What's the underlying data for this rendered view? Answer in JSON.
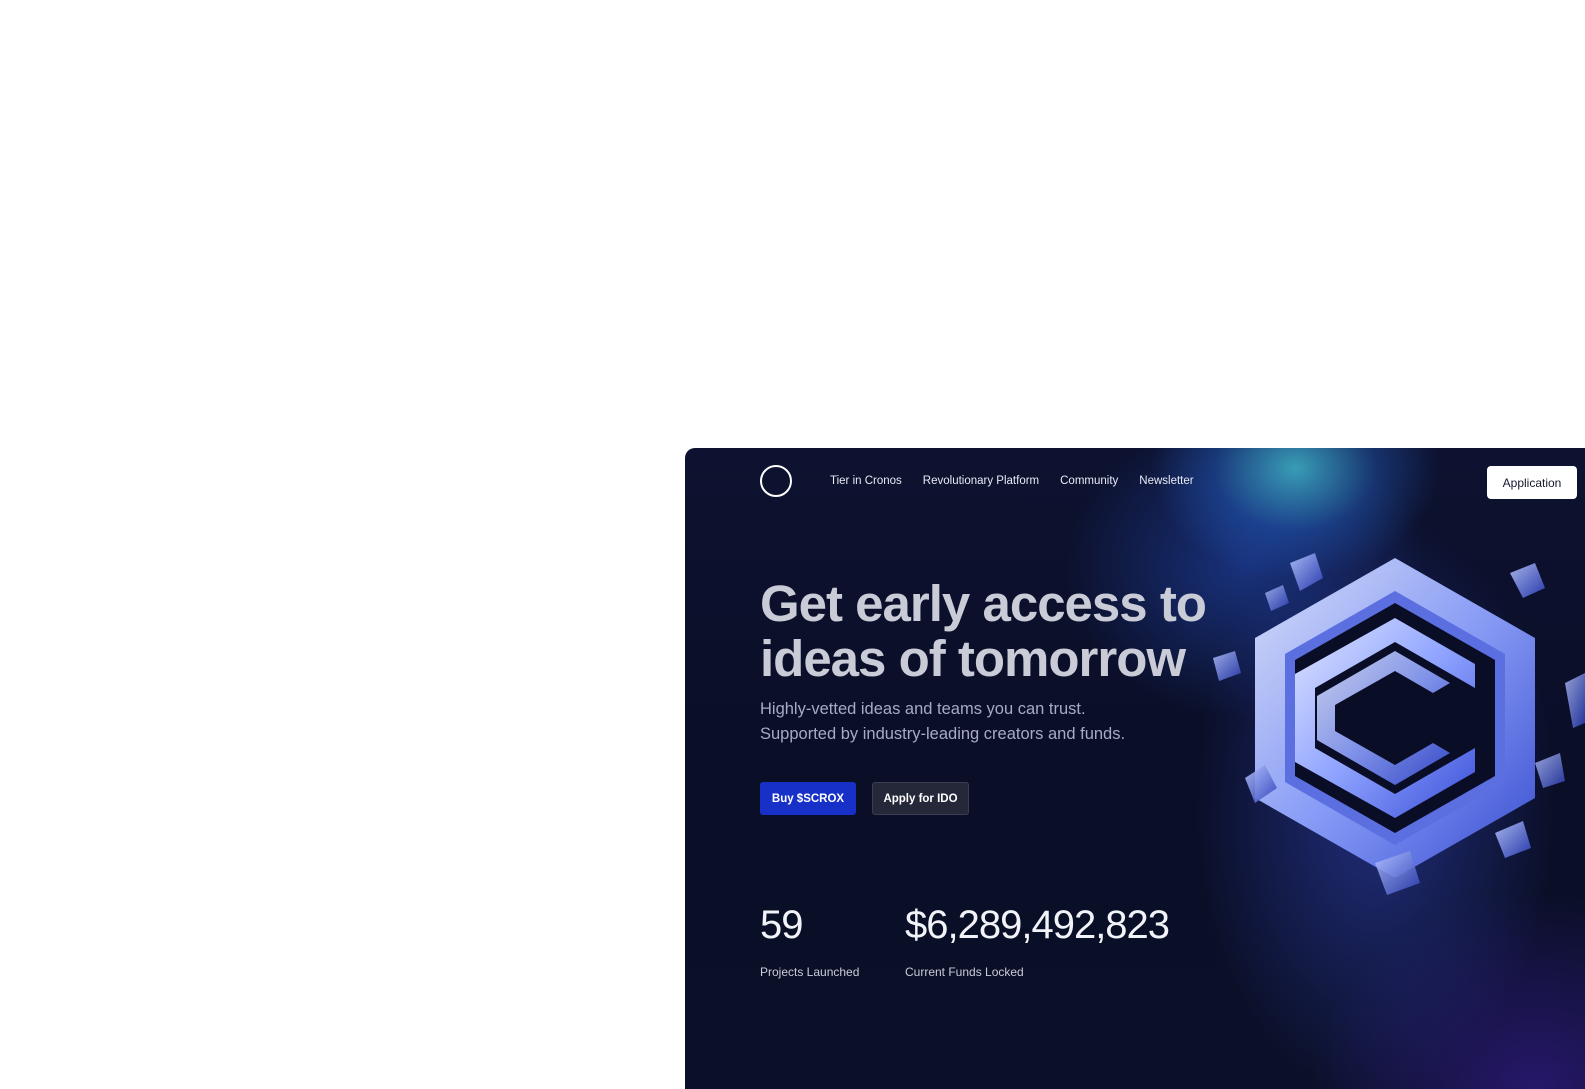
{
  "nav": {
    "links": [
      "Tier in Cronos",
      "Revolutionary Platform",
      "Community",
      "Newsletter"
    ],
    "cta_label": "Application",
    "logo_icon": "circle-logo-icon"
  },
  "hero": {
    "headline_line1": "Get early access to",
    "headline_line2": "ideas of tomorrow",
    "subtitle_line1": "Highly-vetted ideas and teams you can trust.",
    "subtitle_line2": "Supported by industry-leading creators and funds.",
    "primary_button": "Buy $SCROX",
    "secondary_button": "Apply for IDO",
    "emblem_icon": "hexagon-c-emblem-icon"
  },
  "stats": [
    {
      "value": "59",
      "label": "Projects Launched"
    },
    {
      "value": "$6,289,492,823",
      "label": "Current Funds Locked"
    }
  ],
  "colors": {
    "background": "#0a0e27",
    "primary_button": "#1730c7",
    "secondary_button": "#252839",
    "accent_glow": "#3ec9d6",
    "emblem": "#8fa3ff"
  }
}
